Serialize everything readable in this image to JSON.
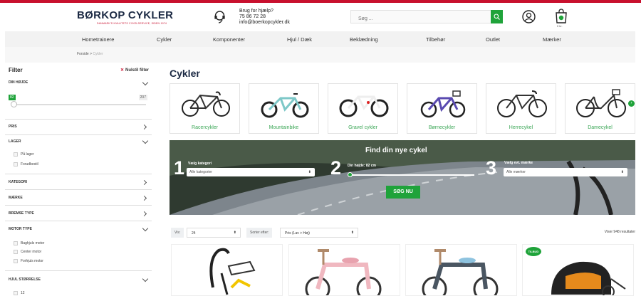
{
  "header": {
    "logo": "BØRKOP CYKLER",
    "tagline": "DANMARK'S KVALITETS CYKELSERVICE, SIDEN 1974",
    "help_line1": "Brug for hjælp?",
    "help_phone": "75 86 72 28",
    "help_email": "info@boerkopcykler.dk",
    "search_placeholder": "Søg ...",
    "cart_total": "0 kr."
  },
  "nav": [
    "Hometrainere",
    "Cykler",
    "Komponenter",
    "Hjul / Dæk",
    "Beklædning",
    "Tilbehør",
    "Outlet",
    "Mærker"
  ],
  "breadcrumb": {
    "home": "Forside",
    "sep": ">",
    "current": "Cykler"
  },
  "filter": {
    "title": "Filter",
    "clear": "Nulstil filter",
    "height_label": "DIN HØJDE",
    "height_min": "82",
    "height_max": "207",
    "price": "PRIS",
    "stock": "LAGER",
    "stock_opts": [
      "På lager",
      "Forudbestil"
    ],
    "category": "KATEGORI",
    "brand": "MÆRKE",
    "brake": "BREMSE TYPE",
    "motor": "MOTOR TYPE",
    "motor_opts": [
      "Baghjuls motor",
      "Center motor",
      "Forhjuls motor"
    ],
    "wheel": "HJUL STØRRELSE",
    "wheel_opts": [
      "12"
    ]
  },
  "main": {
    "title": "Cykler",
    "categories": [
      "Racercykler",
      "Mountainbike",
      "Gravel cykler",
      "Børnecykler",
      "Herrecykel",
      "Damecykel"
    ]
  },
  "finder": {
    "title": "Find din nye cykel",
    "step1_num": "1",
    "step1_label": "Vælg kategori",
    "step1_value": "Alle kategorier",
    "step2_num": "2",
    "step2_label": "Din højde: 82 cm",
    "step3_num": "3",
    "step3_label": "Vælg evt. mærke",
    "step3_value": "Alle mærker",
    "button": "SØG NU"
  },
  "toolbar": {
    "show_label": "Vis:",
    "show_value": "24",
    "sort_label": "Sorter efter:",
    "sort_value": "Pris (Lav > Høj)",
    "count": "Viser 948 resultater"
  },
  "products": {
    "badge": "TILBUD"
  },
  "colors": {
    "accent": "#1fa33a",
    "brand_red": "#c8102e",
    "navy": "#1c2a44"
  }
}
